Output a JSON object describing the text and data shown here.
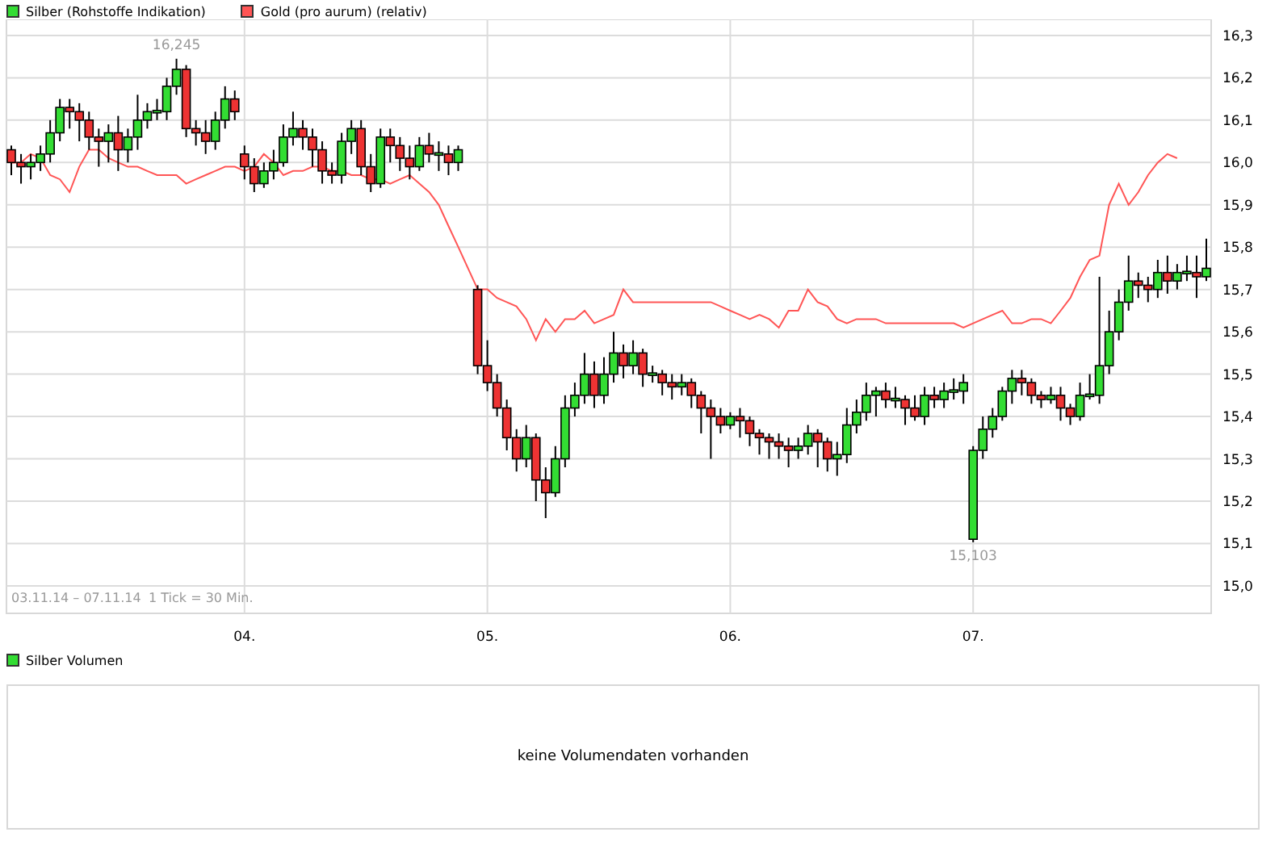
{
  "chart": {
    "chart_data": {
      "type": "candlestick",
      "grid": true,
      "ylim": [
        14.935,
        16.338
      ],
      "categories": [
        null,
        null,
        null,
        null,
        null,
        null,
        null,
        null,
        null,
        null,
        null,
        null,
        null,
        null,
        null,
        null,
        null,
        null,
        null,
        null,
        null,
        null,
        null,
        null,
        "04.",
        null,
        null,
        null,
        null,
        null,
        null,
        null,
        null,
        null,
        null,
        null,
        null,
        null,
        null,
        null,
        null,
        null,
        null,
        null,
        null,
        null,
        null,
        null,
        null,
        "05.",
        null,
        null,
        null,
        null,
        null,
        null,
        null,
        null,
        null,
        null,
        null,
        null,
        null,
        null,
        null,
        null,
        null,
        null,
        null,
        null,
        null,
        null,
        null,
        null,
        "06.",
        null,
        null,
        null,
        null,
        null,
        null,
        null,
        null,
        null,
        null,
        null,
        null,
        null,
        null,
        null,
        null,
        null,
        null,
        null,
        null,
        null,
        null,
        null,
        null,
        "07.",
        null,
        null,
        null,
        null,
        null,
        null,
        null,
        null,
        null,
        null,
        null,
        null,
        null,
        null,
        null,
        null,
        null,
        null,
        null,
        null,
        null,
        null,
        null,
        null
      ],
      "yticks": [
        {
          "value": 15.0,
          "label": "15,0"
        },
        {
          "value": 15.1,
          "label": "15,1"
        },
        {
          "value": 15.2,
          "label": "15,2"
        },
        {
          "value": 15.3,
          "label": "15,3"
        },
        {
          "value": 15.4,
          "label": "15,4"
        },
        {
          "value": 15.5,
          "label": "15,5"
        },
        {
          "value": 15.6,
          "label": "15,6"
        },
        {
          "value": 15.7,
          "label": "15,7"
        },
        {
          "value": 15.8,
          "label": "15,8"
        },
        {
          "value": 15.9,
          "label": "15,9"
        },
        {
          "value": 16.0,
          "label": "16,0"
        },
        {
          "value": 16.1,
          "label": "16,1"
        },
        {
          "value": 16.2,
          "label": "16,2"
        },
        {
          "value": 16.3,
          "label": "16,3"
        }
      ],
      "series": [
        {
          "name": "Silber (Rohstoffe Indikation)",
          "ohlc": [
            [
              16.03,
              16.04,
              15.97,
              16.0
            ],
            [
              16.0,
              16.02,
              15.95,
              15.99
            ],
            [
              15.99,
              16.02,
              15.96,
              16.0
            ],
            [
              16.0,
              16.04,
              15.98,
              16.02
            ],
            [
              16.02,
              16.1,
              16.0,
              16.07
            ],
            [
              16.07,
              16.15,
              16.05,
              16.13
            ],
            [
              16.13,
              16.15,
              16.08,
              16.12
            ],
            [
              16.12,
              16.14,
              16.05,
              16.1
            ],
            [
              16.1,
              16.12,
              16.03,
              16.06
            ],
            [
              16.06,
              16.08,
              15.99,
              16.05
            ],
            [
              16.05,
              16.09,
              16.0,
              16.07
            ],
            [
              16.07,
              16.11,
              15.98,
              16.03
            ],
            [
              16.03,
              16.08,
              16.0,
              16.06
            ],
            [
              16.06,
              16.16,
              16.03,
              16.1
            ],
            [
              16.1,
              16.14,
              16.08,
              16.12
            ],
            [
              16.12,
              16.15,
              16.1,
              16.12
            ],
            [
              16.12,
              16.2,
              16.1,
              16.18
            ],
            [
              16.18,
              16.245,
              16.16,
              16.22
            ],
            [
              16.22,
              16.23,
              16.06,
              16.08
            ],
            [
              16.08,
              16.1,
              16.04,
              16.07
            ],
            [
              16.07,
              16.1,
              16.02,
              16.05
            ],
            [
              16.05,
              16.12,
              16.03,
              16.1
            ],
            [
              16.1,
              16.18,
              16.08,
              16.15
            ],
            [
              16.15,
              16.17,
              16.1,
              16.12
            ],
            [
              16.02,
              16.04,
              15.96,
              15.99
            ],
            [
              15.99,
              16.01,
              15.93,
              15.95
            ],
            [
              15.95,
              16.0,
              15.94,
              15.98
            ],
            [
              15.98,
              16.03,
              15.96,
              16.0
            ],
            [
              16.0,
              16.09,
              15.99,
              16.06
            ],
            [
              16.06,
              16.12,
              16.04,
              16.08
            ],
            [
              16.08,
              16.1,
              16.03,
              16.06
            ],
            [
              16.06,
              16.08,
              15.99,
              16.03
            ],
            [
              16.03,
              16.05,
              15.95,
              15.98
            ],
            [
              15.98,
              16.0,
              15.95,
              15.97
            ],
            [
              15.97,
              16.07,
              15.95,
              16.05
            ],
            [
              16.05,
              16.1,
              16.02,
              16.08
            ],
            [
              16.08,
              16.1,
              15.97,
              15.99
            ],
            [
              15.99,
              16.02,
              15.93,
              15.95
            ],
            [
              15.95,
              16.08,
              15.94,
              16.06
            ],
            [
              16.06,
              16.08,
              16.0,
              16.04
            ],
            [
              16.04,
              16.06,
              15.98,
              16.01
            ],
            [
              16.01,
              16.04,
              15.96,
              15.99
            ],
            [
              15.99,
              16.06,
              15.98,
              16.04
            ],
            [
              16.04,
              16.07,
              16.0,
              16.02
            ],
            [
              16.02,
              16.05,
              15.98,
              16.02
            ],
            [
              16.02,
              16.04,
              15.97,
              16.0
            ],
            [
              16.0,
              16.04,
              15.98,
              16.03
            ],
            null,
            [
              15.7,
              15.71,
              15.5,
              15.52
            ],
            [
              15.52,
              15.58,
              15.46,
              15.48
            ],
            [
              15.48,
              15.5,
              15.4,
              15.42
            ],
            [
              15.42,
              15.44,
              15.32,
              15.35
            ],
            [
              15.35,
              15.37,
              15.27,
              15.3
            ],
            [
              15.3,
              15.38,
              15.28,
              15.35
            ],
            [
              15.35,
              15.36,
              15.2,
              15.25
            ],
            [
              15.25,
              15.28,
              15.16,
              15.22
            ],
            [
              15.22,
              15.33,
              15.21,
              15.3
            ],
            [
              15.3,
              15.45,
              15.28,
              15.42
            ],
            [
              15.42,
              15.48,
              15.4,
              15.45
            ],
            [
              15.45,
              15.55,
              15.43,
              15.5
            ],
            [
              15.5,
              15.53,
              15.42,
              15.45
            ],
            [
              15.45,
              15.54,
              15.43,
              15.5
            ],
            [
              15.5,
              15.6,
              15.48,
              15.55
            ],
            [
              15.55,
              15.57,
              15.49,
              15.52
            ],
            [
              15.52,
              15.58,
              15.5,
              15.55
            ],
            [
              15.55,
              15.56,
              15.47,
              15.5
            ],
            [
              15.5,
              15.52,
              15.48,
              15.5
            ],
            [
              15.5,
              15.51,
              15.45,
              15.48
            ],
            [
              15.48,
              15.5,
              15.44,
              15.47
            ],
            [
              15.47,
              15.5,
              15.45,
              15.48
            ],
            [
              15.48,
              15.49,
              15.42,
              15.45
            ],
            [
              15.45,
              15.46,
              15.36,
              15.42
            ],
            [
              15.42,
              15.44,
              15.3,
              15.4
            ],
            [
              15.4,
              15.42,
              15.36,
              15.38
            ],
            [
              15.38,
              15.41,
              15.37,
              15.4
            ],
            [
              15.4,
              15.42,
              15.35,
              15.39
            ],
            [
              15.39,
              15.4,
              15.33,
              15.36
            ],
            [
              15.36,
              15.37,
              15.31,
              15.35
            ],
            [
              15.35,
              15.36,
              15.3,
              15.34
            ],
            [
              15.34,
              15.36,
              15.3,
              15.33
            ],
            [
              15.33,
              15.35,
              15.28,
              15.32
            ],
            [
              15.32,
              15.35,
              15.3,
              15.33
            ],
            [
              15.33,
              15.38,
              15.31,
              15.36
            ],
            [
              15.36,
              15.37,
              15.28,
              15.34
            ],
            [
              15.34,
              15.35,
              15.27,
              15.3
            ],
            [
              15.3,
              15.34,
              15.26,
              15.31
            ],
            [
              15.31,
              15.42,
              15.29,
              15.38
            ],
            [
              15.38,
              15.44,
              15.36,
              15.41
            ],
            [
              15.41,
              15.48,
              15.39,
              15.45
            ],
            [
              15.45,
              15.47,
              15.4,
              15.46
            ],
            [
              15.46,
              15.48,
              15.42,
              15.44
            ],
            [
              15.44,
              15.47,
              15.42,
              15.44
            ],
            [
              15.44,
              15.45,
              15.38,
              15.42
            ],
            [
              15.42,
              15.45,
              15.39,
              15.4
            ],
            [
              15.4,
              15.47,
              15.38,
              15.45
            ],
            [
              15.45,
              15.47,
              15.42,
              15.44
            ],
            [
              15.44,
              15.48,
              15.42,
              15.46
            ],
            [
              15.46,
              15.49,
              15.44,
              15.46
            ],
            [
              15.46,
              15.5,
              15.43,
              15.48
            ],
            [
              15.11,
              15.33,
              15.103,
              15.32
            ],
            [
              15.32,
              15.4,
              15.3,
              15.37
            ],
            [
              15.37,
              15.42,
              15.35,
              15.4
            ],
            [
              15.4,
              15.47,
              15.39,
              15.46
            ],
            [
              15.46,
              15.51,
              15.43,
              15.49
            ],
            [
              15.49,
              15.51,
              15.45,
              15.48
            ],
            [
              15.48,
              15.49,
              15.43,
              15.45
            ],
            [
              15.45,
              15.46,
              15.42,
              15.44
            ],
            [
              15.44,
              15.47,
              15.43,
              15.45
            ],
            [
              15.45,
              15.47,
              15.39,
              15.42
            ],
            [
              15.42,
              15.43,
              15.38,
              15.4
            ],
            [
              15.4,
              15.48,
              15.39,
              15.45
            ],
            [
              15.45,
              15.5,
              15.44,
              15.45
            ],
            [
              15.45,
              15.73,
              15.43,
              15.52
            ],
            [
              15.52,
              15.65,
              15.5,
              15.6
            ],
            [
              15.6,
              15.7,
              15.58,
              15.67
            ],
            [
              15.67,
              15.78,
              15.65,
              15.72
            ],
            [
              15.72,
              15.74,
              15.68,
              15.71
            ],
            [
              15.71,
              15.73,
              15.67,
              15.7
            ],
            [
              15.7,
              15.77,
              15.68,
              15.74
            ],
            [
              15.74,
              15.78,
              15.69,
              15.72
            ],
            [
              15.72,
              15.76,
              15.7,
              15.74
            ],
            [
              15.74,
              15.78,
              15.72,
              15.74
            ],
            [
              15.74,
              15.78,
              15.68,
              15.73
            ],
            [
              15.73,
              15.82,
              15.72,
              15.75
            ]
          ]
        },
        {
          "name": "Gold (pro aurum) (relativ)",
          "type": "line",
          "color": "#ff5555",
          "values": [
            16.0,
            16.0,
            16.02,
            16.01,
            15.97,
            15.96,
            15.93,
            15.99,
            16.03,
            16.03,
            16.01,
            16.0,
            15.99,
            15.99,
            15.98,
            15.97,
            15.97,
            15.97,
            15.95,
            15.96,
            15.97,
            15.98,
            15.99,
            15.99,
            15.98,
            15.99,
            16.02,
            16.0,
            15.97,
            15.98,
            15.98,
            15.99,
            15.99,
            15.98,
            15.98,
            15.97,
            15.97,
            15.96,
            15.96,
            15.95,
            15.96,
            15.97,
            15.95,
            15.93,
            15.9,
            15.85,
            15.8,
            15.75,
            15.7,
            15.7,
            15.68,
            15.67,
            15.66,
            15.63,
            15.58,
            15.63,
            15.6,
            15.63,
            15.63,
            15.65,
            15.62,
            15.63,
            15.64,
            15.7,
            15.67,
            15.67,
            15.67,
            15.67,
            15.67,
            15.67,
            15.67,
            15.67,
            15.67,
            15.66,
            15.65,
            15.64,
            15.63,
            15.64,
            15.63,
            15.61,
            15.65,
            15.65,
            15.7,
            15.67,
            15.66,
            15.63,
            15.62,
            15.63,
            15.63,
            15.63,
            15.62,
            15.62,
            15.62,
            15.62,
            15.62,
            15.62,
            15.62,
            15.62,
            15.61,
            15.62,
            15.63,
            15.64,
            15.65,
            15.62,
            15.62,
            15.63,
            15.63,
            15.62,
            15.65,
            15.68,
            15.73,
            15.77,
            15.78,
            15.9,
            15.95,
            15.9,
            15.93,
            15.97,
            16.0,
            16.02,
            16.01,
            null,
            null,
            null
          ]
        }
      ],
      "annotations": [
        "16,245",
        "15,103"
      ]
    },
    "range": "03.11.14 – 07.11.14",
    "tick_size": "1 Tick = 30 Min."
  },
  "volume": {
    "legend": "Silber Volumen",
    "color": "#33dd33",
    "message": "keine Volumendaten vorhanden"
  }
}
